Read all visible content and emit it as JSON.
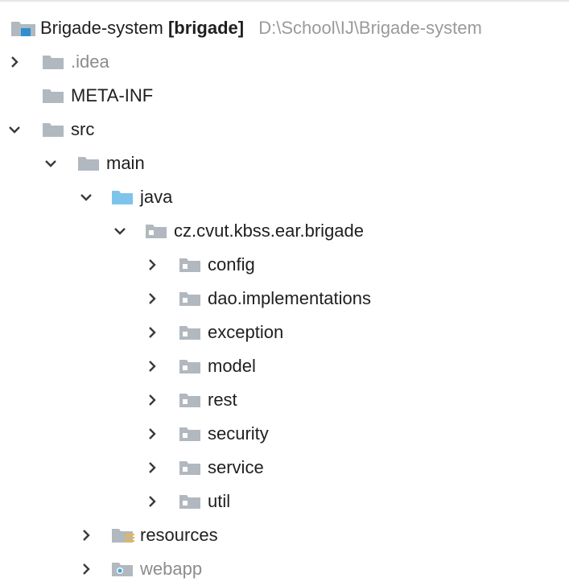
{
  "project": {
    "name": "Brigade-system",
    "module": "[brigade]",
    "path": "D:\\School\\IJ\\Brigade-system"
  },
  "items": {
    "idea": ".idea",
    "meta_inf": "META-INF",
    "src": "src",
    "main": "main",
    "java": "java",
    "package": "cz.cvut.kbss.ear.brigade",
    "subpackages": [
      "config",
      "dao.implementations",
      "exception",
      "model",
      "rest",
      "security",
      "service",
      "util"
    ],
    "resources": "resources",
    "webapp": "webapp"
  },
  "icons": {
    "folder": "folder-icon",
    "source_folder": "source-folder-icon",
    "package": "package-icon",
    "resources_folder": "resources-folder-icon",
    "web_folder": "web-folder-icon",
    "project": "project-module-icon",
    "expanded": "chevron-down-icon",
    "collapsed": "chevron-right-icon"
  },
  "colors": {
    "folder": "#b1b8bf",
    "source_folder": "#7ec4ea",
    "package_dot": "#ffffff",
    "resources_lines": "#e8b64a",
    "web_dot": "#48a6d8",
    "module_blue": "#2f8fd1",
    "muted_text": "#8c8c8c",
    "path_text": "#9a9a9a"
  }
}
